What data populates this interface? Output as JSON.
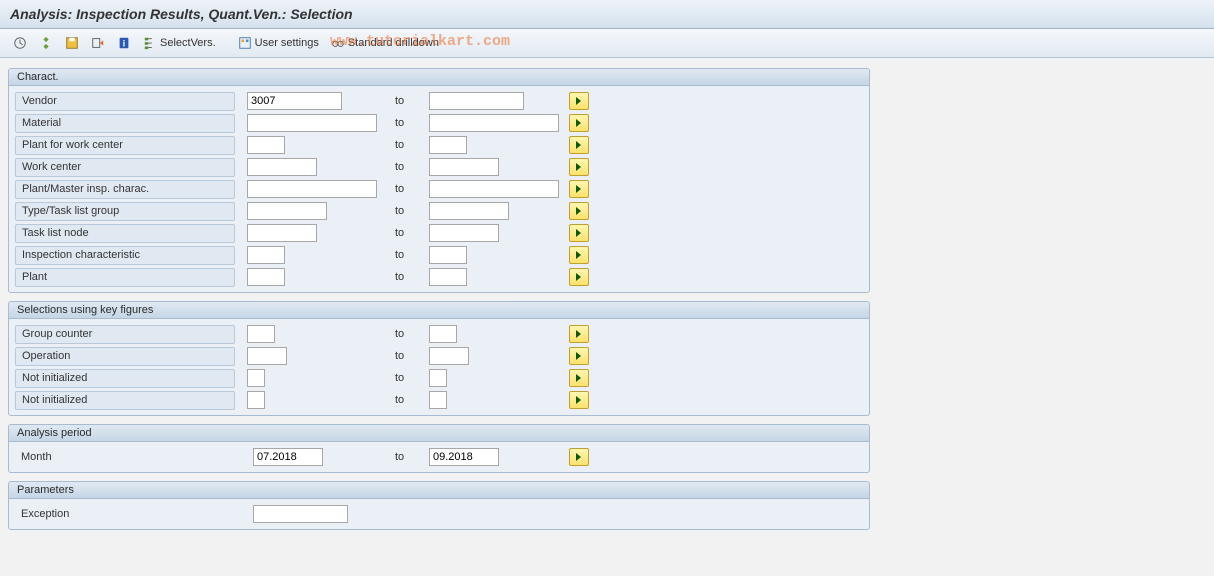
{
  "title": "Analysis: Inspection Results, Quant.Ven.: Selection",
  "watermark": "www.tutorialkart.com",
  "toolbar": {
    "select_vers": "SelectVers.",
    "user_settings": "User settings",
    "std_drilldown": "Standard drilldown"
  },
  "groups": {
    "charact": {
      "title": "Charact.",
      "rows": [
        {
          "label": "Vendor",
          "from_w": 95,
          "to_w": 95,
          "from_val": "3007"
        },
        {
          "label": "Material",
          "from_w": 130,
          "to_w": 130
        },
        {
          "label": "Plant for work center",
          "from_w": 38,
          "to_w": 38
        },
        {
          "label": "Work center",
          "from_w": 70,
          "to_w": 70
        },
        {
          "label": "Plant/Master insp. charac.",
          "from_w": 130,
          "to_w": 130
        },
        {
          "label": "Type/Task list group",
          "from_w": 80,
          "to_w": 80
        },
        {
          "label": "Task list node",
          "from_w": 70,
          "to_w": 70
        },
        {
          "label": "Inspection characteristic",
          "from_w": 38,
          "to_w": 38
        },
        {
          "label": "Plant",
          "from_w": 38,
          "to_w": 38
        }
      ]
    },
    "keyfig": {
      "title": "Selections using key figures",
      "rows": [
        {
          "label": "Group counter",
          "from_w": 28,
          "to_w": 28
        },
        {
          "label": "Operation",
          "from_w": 40,
          "to_w": 40
        },
        {
          "label": "Not initialized",
          "from_w": 18,
          "to_w": 18
        },
        {
          "label": "Not initialized",
          "from_w": 18,
          "to_w": 18
        }
      ]
    },
    "period": {
      "title": "Analysis period",
      "rows": [
        {
          "label": "Month",
          "from_w": 70,
          "to_w": 70,
          "from_val": "07.2018",
          "to_val": "09.2018"
        }
      ]
    },
    "params": {
      "title": "Parameters",
      "rows": [
        {
          "label": "Exception",
          "from_w": 95
        }
      ]
    }
  },
  "to_text": "to"
}
